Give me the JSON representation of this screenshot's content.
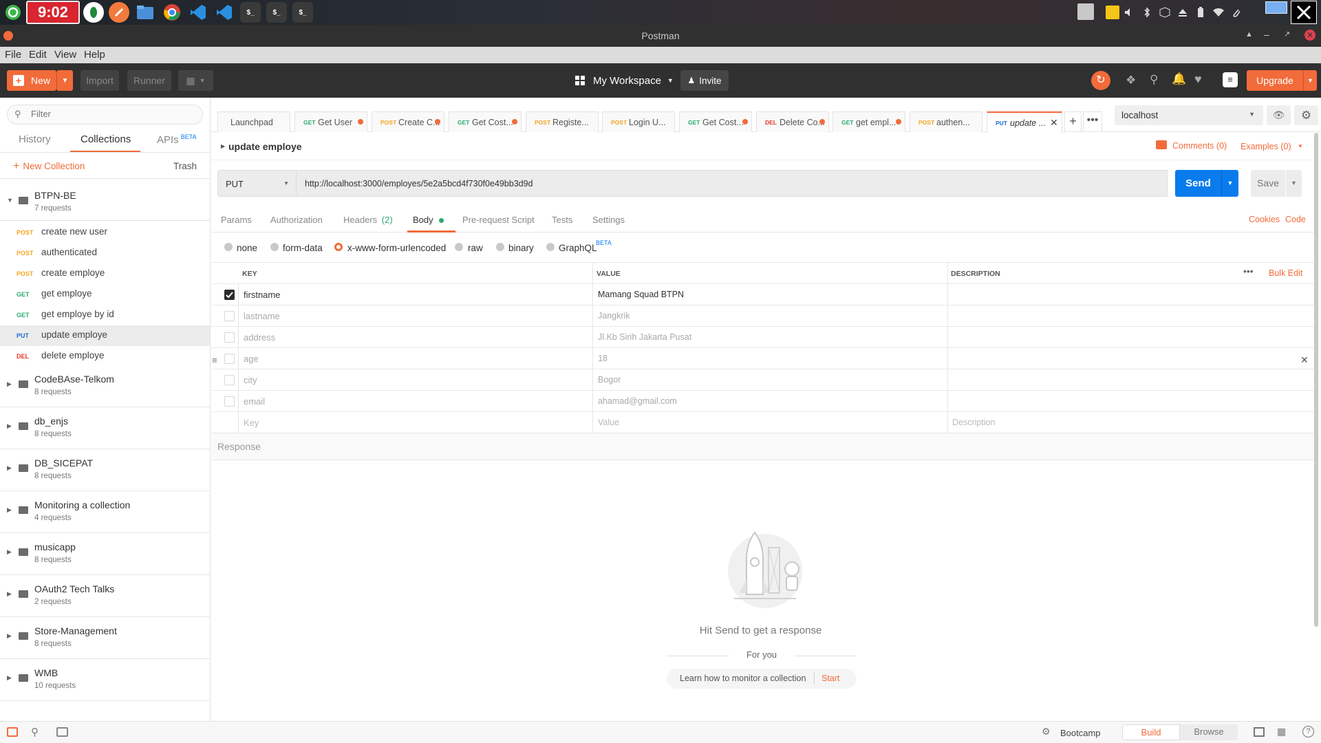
{
  "os": {
    "clock": "9:02",
    "dock": [
      "start-menu-icon",
      "vpn-icon",
      "browser-compass-icon",
      "files-icon",
      "chrome-icon",
      "vscode-icon",
      "vscode-icon-2",
      "terminal-icon",
      "terminal-icon-2",
      "terminal-icon-3"
    ],
    "terminal_glyph": "$_"
  },
  "window": {
    "title": "Postman"
  },
  "menu": [
    "File",
    "Edit",
    "View",
    "Help"
  ],
  "header": {
    "new_label": "New",
    "import_label": "Import",
    "runner_label": "Runner",
    "workspace_label": "My Workspace",
    "invite_label": "Invite",
    "upgrade_label": "Upgrade"
  },
  "sidebar": {
    "filter_placeholder": "Filter",
    "tabs": [
      "History",
      "Collections",
      "APIs"
    ],
    "apis_badge": "BETA",
    "new_collection": "New Collection",
    "trash": "Trash",
    "open_collection": {
      "name": "BTPN-BE",
      "count": "7 requests",
      "requests": [
        {
          "method": "POST",
          "name": "create new user"
        },
        {
          "method": "POST",
          "name": "authenticated"
        },
        {
          "method": "POST",
          "name": "create employe"
        },
        {
          "method": "GET",
          "name": "get employe"
        },
        {
          "method": "GET",
          "name": "get employe by id"
        },
        {
          "method": "PUT",
          "name": "update employe"
        },
        {
          "method": "DEL",
          "name": "delete employe"
        }
      ]
    },
    "collections": [
      {
        "name": "CodeBAse-Telkom",
        "count": "8 requests"
      },
      {
        "name": "db_enjs",
        "count": "8 requests"
      },
      {
        "name": "DB_SICEPAT",
        "count": "8 requests"
      },
      {
        "name": "Monitoring a collection",
        "count": "4 requests"
      },
      {
        "name": "musicapp",
        "count": "8 requests"
      },
      {
        "name": "OAuth2 Tech Talks",
        "count": "2 requests"
      },
      {
        "name": "Store-Management",
        "count": "8 requests"
      },
      {
        "name": "WMB",
        "count": "10 requests"
      }
    ]
  },
  "tabs": [
    {
      "method": "",
      "name": "Launchpad",
      "dot": false
    },
    {
      "method": "GET",
      "name": "Get User",
      "dot": true
    },
    {
      "method": "POST",
      "name": "Create C...",
      "dot": true
    },
    {
      "method": "GET",
      "name": "Get Cost...",
      "dot": true
    },
    {
      "method": "POST",
      "name": "Registe...",
      "dot": false
    },
    {
      "method": "POST",
      "name": "Login U...",
      "dot": false
    },
    {
      "method": "GET",
      "name": "Get Cost...",
      "dot": true
    },
    {
      "method": "DEL",
      "name": "Delete Co...",
      "dot": true
    },
    {
      "method": "GET",
      "name": "get empl...",
      "dot": true
    },
    {
      "method": "POST",
      "name": "authen...",
      "dot": false
    },
    {
      "method": "PUT",
      "name": "update ...",
      "dot": false,
      "active": true
    }
  ],
  "environment": "localhost",
  "request": {
    "name": "update employe",
    "comments": "Comments (0)",
    "examples": "Examples (0)",
    "method": "PUT",
    "url": "http://localhost:3000/employes/5e2a5bcd4f730f0e49bb3d9d",
    "send_label": "Send",
    "save_label": "Save"
  },
  "subtabs": {
    "items": [
      "Params",
      "Authorization",
      "Headers",
      "Body",
      "Pre-request Script",
      "Tests",
      "Settings"
    ],
    "headers_count": "(2)",
    "cookies": "Cookies",
    "code": "Code"
  },
  "body_types": {
    "options": [
      "none",
      "form-data",
      "x-www-form-urlencoded",
      "raw",
      "binary",
      "GraphQL"
    ],
    "graphql_badge": "BETA",
    "selected": "x-www-form-urlencoded"
  },
  "kv": {
    "headers": [
      "KEY",
      "VALUE",
      "DESCRIPTION"
    ],
    "bulk_edit": "Bulk Edit",
    "rows": [
      {
        "key": "firstname",
        "value": "Mamang Squad BTPN",
        "checked": true
      },
      {
        "key": "lastname",
        "value": "Jangkrik",
        "checked": false
      },
      {
        "key": "address",
        "value": "Jl.Kb Sirih Jakarta Pusat",
        "checked": false
      },
      {
        "key": "age",
        "value": "18",
        "checked": false
      },
      {
        "key": "city",
        "value": "Bogor",
        "checked": false
      },
      {
        "key": "email",
        "value": "ahamad@gmail.com",
        "checked": false
      }
    ],
    "placeholder_key": "Key",
    "placeholder_value": "Value",
    "placeholder_description": "Description"
  },
  "response": {
    "label": "Response",
    "hint": "Hit Send to get a response",
    "for_you": "For you",
    "learn": "Learn how to monitor a collection",
    "start": "Start"
  },
  "statusbar": {
    "bootcamp": "Bootcamp",
    "build": "Build",
    "browse": "Browse"
  },
  "colors": {
    "accent": "#f26b3a",
    "send": "#097bed",
    "post": "#f5a623",
    "get": "#2ca86f",
    "put": "#1f6fd0",
    "del": "#e0382b",
    "dark": "#303030"
  }
}
